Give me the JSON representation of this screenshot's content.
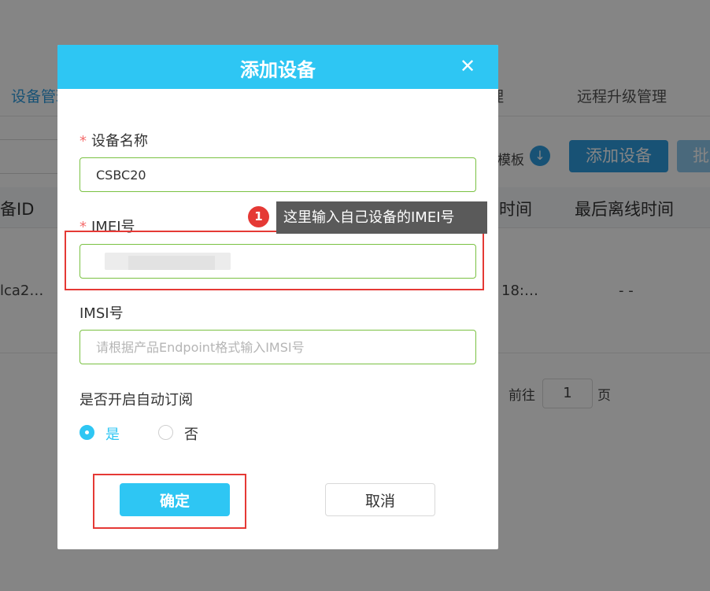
{
  "background": {
    "tabs": [
      {
        "label": "设备管理",
        "active": true
      },
      {
        "label": "管理",
        "active": false
      },
      {
        "label": "远程升级管理",
        "active": false
      }
    ],
    "template_link": "模板",
    "download_icon": "download-icon",
    "add_device_button": "添加设备",
    "batch_button": "批量",
    "table_headers": [
      "备ID",
      "时间",
      "最后离线时间"
    ],
    "table_row": {
      "device_id": "lca2…",
      "time": "18:…",
      "offline_time": "- -"
    },
    "pagination": {
      "goto_label": "前往",
      "page_value": "1",
      "page_unit": "页"
    }
  },
  "modal": {
    "title": "添加设备",
    "close_icon": "close-icon",
    "fields": {
      "device_name": {
        "label": "设备名称",
        "required": true,
        "value": "CSBC20",
        "placeholder": ""
      },
      "imei": {
        "label": "IMEI号",
        "required": true,
        "value": "",
        "placeholder": ""
      },
      "imsi": {
        "label": "IMSI号",
        "required": false,
        "value": "",
        "placeholder": "请根据产品Endpoint格式输入IMSI号"
      }
    },
    "auto_subscribe": {
      "label": "是否开启自动订阅",
      "options": [
        {
          "label": "是",
          "checked": true
        },
        {
          "label": "否",
          "checked": false
        }
      ]
    },
    "confirm_button": "确定",
    "cancel_button": "取消"
  },
  "annotation": {
    "badge_number": "1",
    "tooltip_text": "这里输入自己设备的IMEI号",
    "highlight_color": "#e53935"
  },
  "colors": {
    "header_bg": "#2ec6f3",
    "primary": "#2ec6f3",
    "input_border": "#7ac142",
    "required_star": "#f56c6c",
    "page_primary": "#2f9de0"
  }
}
